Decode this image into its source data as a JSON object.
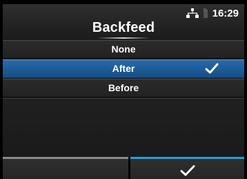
{
  "header": {
    "title": "Backfeed",
    "status": {
      "network_icon": "network-icon",
      "sd_icon": "sd-card-icon",
      "time": "16:29"
    }
  },
  "options": {
    "items": [
      {
        "label": "None",
        "selected": false
      },
      {
        "label": "After",
        "selected": true,
        "check_icon": "checkmark-icon"
      },
      {
        "label": "Before",
        "selected": false
      }
    ]
  },
  "footer": {
    "left_button": {
      "label": ""
    },
    "right_button": {
      "icon": "checkmark-icon"
    }
  },
  "colors": {
    "selected_row": "#1e5c98",
    "confirm_bar": "#1fa0e6",
    "back_bar": "#8a8a8a"
  }
}
